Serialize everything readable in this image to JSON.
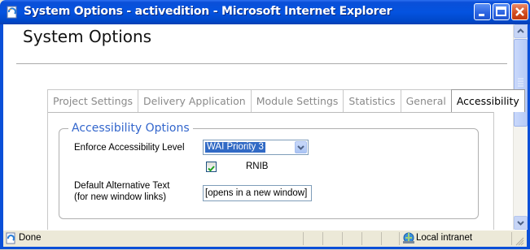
{
  "window": {
    "title": "System Options - activedition - Microsoft Internet Explorer"
  },
  "page": {
    "title": "System Options"
  },
  "tabs": [
    {
      "label": "Project Settings",
      "active": false
    },
    {
      "label": "Delivery Application",
      "active": false
    },
    {
      "label": "Module Settings",
      "active": false
    },
    {
      "label": "Statistics",
      "active": false
    },
    {
      "label": "General",
      "active": false
    },
    {
      "label": "Accessibility",
      "active": true
    }
  ],
  "accessibility": {
    "legend": "Accessibility Options",
    "enforce_label": "Enforce Accessibility Level",
    "enforce_value": "WAI Priority 3",
    "rnib_label": "RNIB",
    "rnib_checked": true,
    "alt_text_label_line1": "Default Alternative Text",
    "alt_text_label_line2": "(for new window links)",
    "alt_text_value": "[opens in a new window]"
  },
  "status": {
    "text": "Done",
    "zone": "Local intranet"
  },
  "colors": {
    "titlebar": "#0453e0",
    "legend": "#3366cc",
    "select_highlight": "#316ac5"
  },
  "icons": {
    "title": "ie-page-icon",
    "status": "ie-page-icon",
    "zone": "local-intranet-icon",
    "check": "checkmark-icon"
  }
}
